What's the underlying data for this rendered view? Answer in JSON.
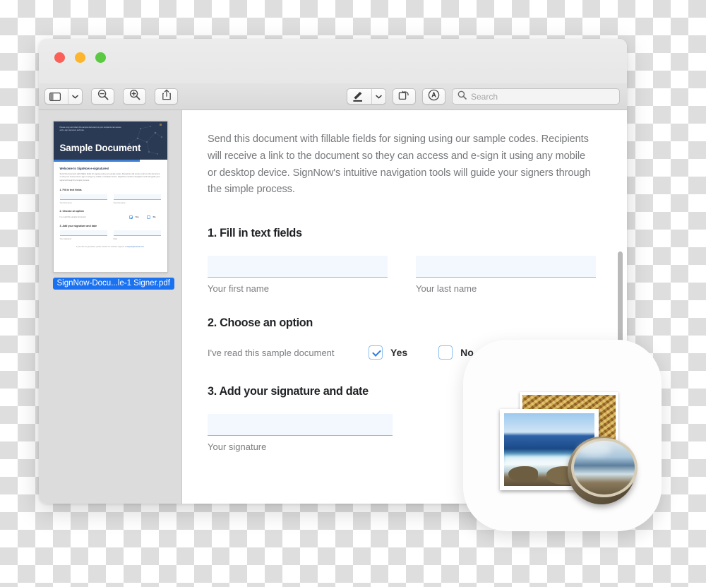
{
  "window": {
    "title": "",
    "traffic_lights": {
      "close": "close-button",
      "minimize": "minimize-button",
      "maximize": "maximize-button"
    }
  },
  "toolbar": {
    "sidebar_toggle": "sidebar-view-icon",
    "sidebar_chevron": "chevron-down-icon",
    "zoom_out": "zoom-out-icon",
    "zoom_in": "zoom-in-icon",
    "share": "share-icon",
    "markup": "markup-pen-icon",
    "markup_chevron": "chevron-down-icon",
    "rotate": "rotate-icon",
    "annotate": "annotate-icon",
    "search_placeholder": "Search",
    "search_value": ""
  },
  "sidebar": {
    "thumbnail": {
      "header_note": "Please copy and share this sample document so your recipients can access and e-sign signature and date.",
      "title": "Sample Document",
      "welcome": "Welcome to SignNow e-signatures!",
      "paragraph": "Send this document with fillable fields for signing using our sample codes. Recipients will receive a link to the document so they can access and e-sign it using any mobile or desktop device. SignNow's intuitive navigation tools will guide your signers through the simple process.",
      "sections": [
        "1. Fill in text fields",
        "2. Choose an option",
        "3. Add your signature and date"
      ],
      "labels": {
        "first_name": "Your first name",
        "last_name": "Your last name",
        "question": "I've read this sample document",
        "yes": "Yes",
        "no": "No",
        "signature": "Your signature",
        "date": "Date"
      },
      "footer": "If you have any questions, please contact our solutions engineer at",
      "footer_link": "support@example.com"
    },
    "file_label": "SignNow-Docu...le-1 Signer.pdf"
  },
  "document": {
    "intro": "Send this document with fillable fields for signing using our sample codes. Recipients will receive a link to the document so they can access and e-sign it using any mobile or desktop device. SignNow's intuitive navigation tools will guide your signers through the simple process.",
    "section1": {
      "heading": "1. Fill in text fields",
      "first_name_value": "",
      "first_name_caption": "Your first name",
      "last_name_value": "",
      "last_name_caption": "Your last name"
    },
    "section2": {
      "heading": "2. Choose an option",
      "question": "I've read this sample document",
      "yes_label": "Yes",
      "yes_checked": true,
      "no_label": "No",
      "no_checked": false
    },
    "section3": {
      "heading": "3. Add your signature and date",
      "signature_value": "",
      "signature_caption": "Your signature"
    }
  },
  "app_icon": {
    "name": "Preview",
    "back_photo": "pebbles-photo",
    "front_photo": "coastline-photo",
    "loupe": "magnifying-loupe"
  },
  "colors": {
    "accent_blue": "#2f7ed8",
    "field_fill": "#f2f8fd",
    "field_underline": "#8dbfee",
    "selection_blue": "#1a72f0",
    "doc_header_navy": "#2b3a54",
    "text_gray": "#77787b"
  }
}
